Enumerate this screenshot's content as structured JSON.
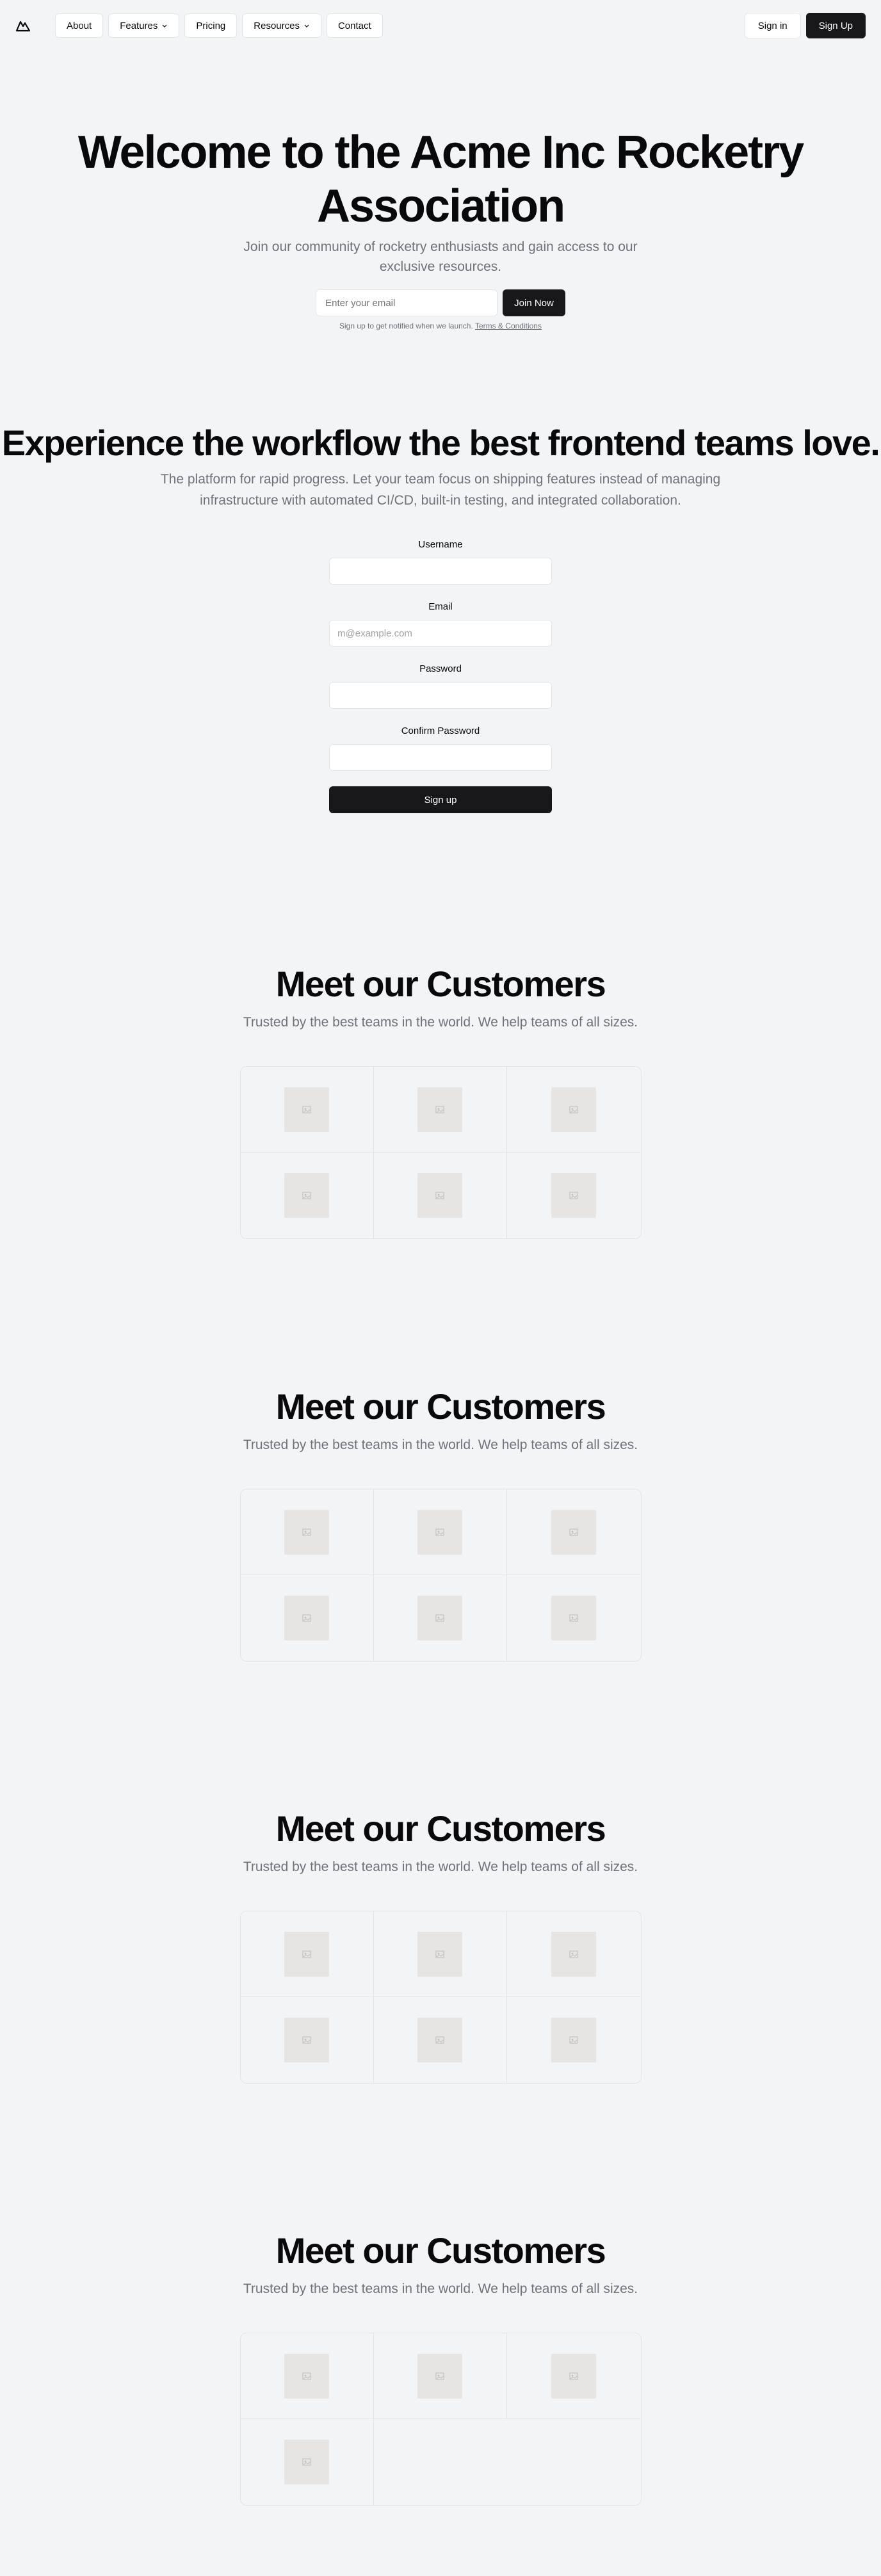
{
  "nav": {
    "logo_icon": "mountain-logo-icon",
    "links": [
      {
        "label": "About",
        "dropdown": false
      },
      {
        "label": "Features",
        "dropdown": true
      },
      {
        "label": "Pricing",
        "dropdown": false
      },
      {
        "label": "Resources",
        "dropdown": true
      },
      {
        "label": "Contact",
        "dropdown": false
      }
    ],
    "sign_in": "Sign in",
    "sign_up": "Sign Up"
  },
  "hero": {
    "title": "Welcome to the Acme Inc Rocketry Association",
    "subtitle": "Join our community of rocketry enthusiasts and gain access to our exclusive resources.",
    "email_placeholder": "Enter your email",
    "join_label": "Join Now",
    "fine_print": "Sign up to get notified when we launch.",
    "terms_link": "Terms & Conditions"
  },
  "signup_section": {
    "title": "Experience the workflow the best frontend teams love.",
    "subtitle": "The platform for rapid progress. Let your team focus on shipping features instead of managing infrastructure with automated CI/CD, built-in testing, and integrated collaboration.",
    "fields": {
      "username_label": "Username",
      "username_value": "",
      "email_label": "Email",
      "email_placeholder": "m@example.com",
      "password_label": "Password",
      "password_value": "",
      "confirm_label": "Confirm Password",
      "confirm_value": ""
    },
    "submit_label": "Sign up"
  },
  "customers": [
    {
      "title": "Meet our Customers",
      "subtitle": "Trusted by the best teams in the world. We help teams of all sizes.",
      "logo_count": 6
    },
    {
      "title": "Meet our Customers",
      "subtitle": "Trusted by the best teams in the world. We help teams of all sizes.",
      "logo_count": 6
    },
    {
      "title": "Meet our Customers",
      "subtitle": "Trusted by the best teams in the world. We help teams of all sizes.",
      "logo_count": 6
    },
    {
      "title": "Meet our Customers",
      "subtitle": "Trusted by the best teams in the world. We help teams of all sizes.",
      "logo_count": 4
    }
  ],
  "colors": {
    "background": "#f3f4f6",
    "primary": "#18181b",
    "muted_text": "#71717a",
    "border": "#e4e4e7",
    "placeholder_tile": "#e7e5e4"
  }
}
